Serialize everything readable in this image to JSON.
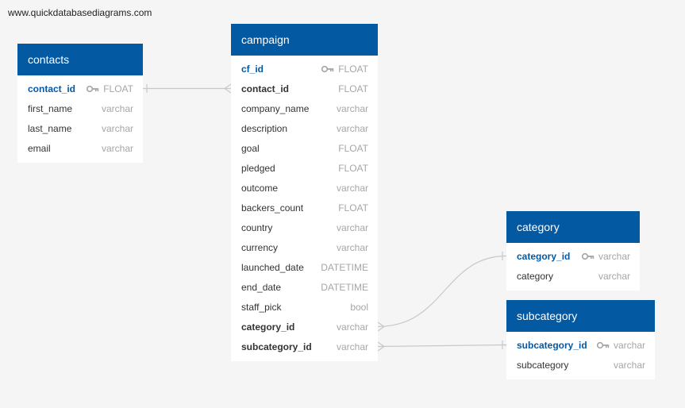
{
  "watermark": "www.quickdatabasediagrams.com",
  "tables": {
    "contacts": {
      "title": "contacts",
      "fields": [
        {
          "name": "contact_id",
          "type": "FLOAT",
          "key": "pk"
        },
        {
          "name": "first_name",
          "type": "varchar",
          "key": ""
        },
        {
          "name": "last_name",
          "type": "varchar",
          "key": ""
        },
        {
          "name": "email",
          "type": "varchar",
          "key": ""
        }
      ]
    },
    "campaign": {
      "title": "campaign",
      "fields": [
        {
          "name": "cf_id",
          "type": "FLOAT",
          "key": "pk"
        },
        {
          "name": "contact_id",
          "type": "FLOAT",
          "key": "fk"
        },
        {
          "name": "company_name",
          "type": "varchar",
          "key": ""
        },
        {
          "name": "description",
          "type": "varchar",
          "key": ""
        },
        {
          "name": "goal",
          "type": "FLOAT",
          "key": ""
        },
        {
          "name": "pledged",
          "type": "FLOAT",
          "key": ""
        },
        {
          "name": "outcome",
          "type": "varchar",
          "key": ""
        },
        {
          "name": "backers_count",
          "type": "FLOAT",
          "key": ""
        },
        {
          "name": "country",
          "type": "varchar",
          "key": ""
        },
        {
          "name": "currency",
          "type": "varchar",
          "key": ""
        },
        {
          "name": "launched_date",
          "type": "DATETIME",
          "key": ""
        },
        {
          "name": "end_date",
          "type": "DATETIME",
          "key": ""
        },
        {
          "name": "staff_pick",
          "type": "bool",
          "key": ""
        },
        {
          "name": "category_id",
          "type": "varchar",
          "key": "fk"
        },
        {
          "name": "subcategory_id",
          "type": "varchar",
          "key": "fk"
        }
      ]
    },
    "category": {
      "title": "category",
      "fields": [
        {
          "name": "category_id",
          "type": "varchar",
          "key": "pk"
        },
        {
          "name": "category",
          "type": "varchar",
          "key": ""
        }
      ]
    },
    "subcategory": {
      "title": "subcategory",
      "fields": [
        {
          "name": "subcategory_id",
          "type": "varchar",
          "key": "pk"
        },
        {
          "name": "subcategory",
          "type": "varchar",
          "key": ""
        }
      ]
    }
  },
  "relationships": [
    {
      "from": "campaign.contact_id",
      "to": "contacts.contact_id"
    },
    {
      "from": "campaign.category_id",
      "to": "category.category_id"
    },
    {
      "from": "campaign.subcategory_id",
      "to": "subcategory.subcategory_id"
    }
  ],
  "colors": {
    "header": "#0459a3",
    "primary_key_text": "#0459a3",
    "type_text": "#a6a6a6",
    "connector": "#c8c8c8",
    "background": "#f4f5f4"
  },
  "icons": {
    "primary_key": "key-icon"
  }
}
